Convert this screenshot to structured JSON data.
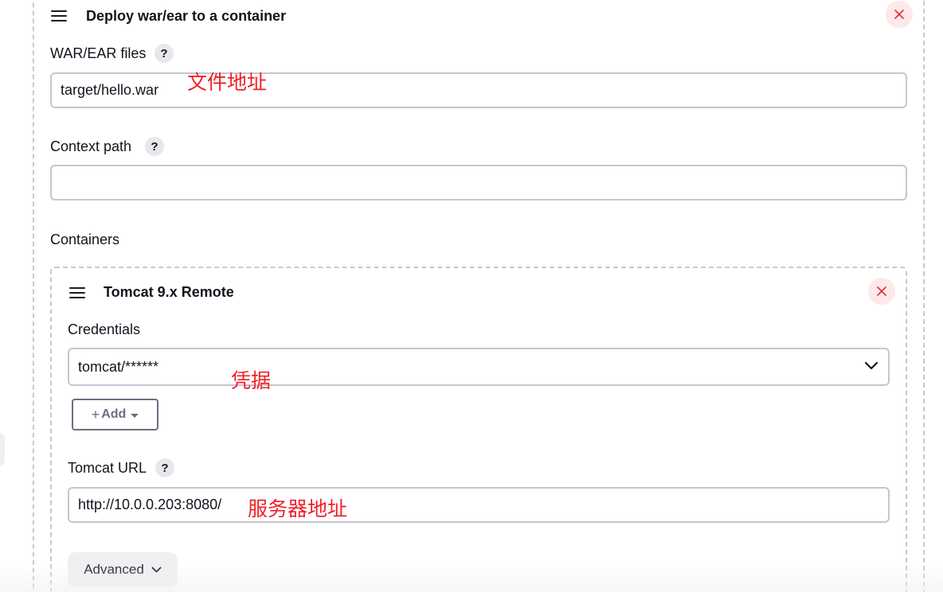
{
  "section": {
    "title": "Deploy war/ear to a container",
    "war_label": "WAR/EAR files",
    "war_value": "target/hello.war",
    "war_annotation": "文件地址",
    "context_label": "Context path",
    "context_value": "",
    "containers_label": "Containers"
  },
  "container": {
    "title": "Tomcat 9.x Remote",
    "credentials_label": "Credentials",
    "credentials_value": "tomcat/******",
    "credentials_annotation": "凭据",
    "add_label": "Add",
    "add_plus": "+",
    "url_label": "Tomcat URL",
    "url_value": "http://10.0.0.203:8080/",
    "url_annotation": "服务器地址",
    "advanced_label": "Advanced"
  },
  "help_glyph": "?",
  "colors": {
    "close_bg": "#fde8ea",
    "close_x": "#e0303a",
    "annotation": "#f0202a",
    "border": "#c6c6cc"
  },
  "icons": {
    "drag": "hamburger-drag-icon",
    "close": "close-icon",
    "help": "help-icon",
    "chevron": "chevron-down-icon",
    "caret": "caret-down-icon"
  }
}
